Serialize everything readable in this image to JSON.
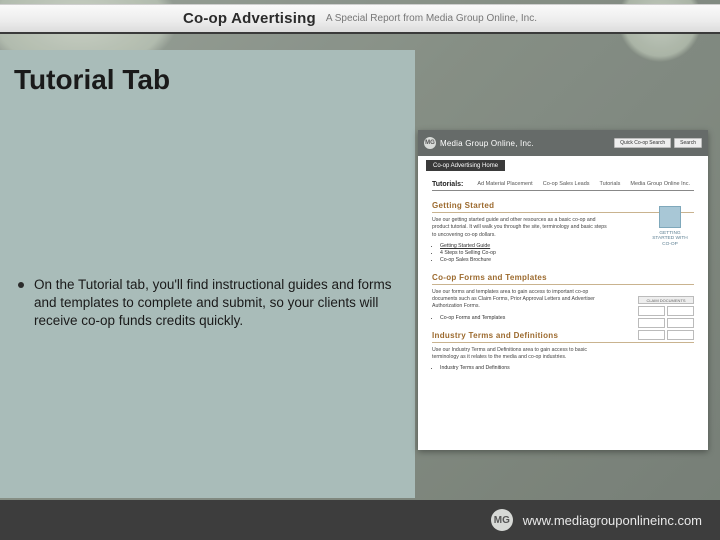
{
  "header": {
    "title": "Co-op Advertising",
    "subtitle": "A Special Report from Media Group Online, Inc."
  },
  "slide": {
    "title": "Tutorial Tab",
    "bullet": "On the Tutorial tab, you'll find instructional guides and forms and templates to complete and submit, so your clients will receive co-op funds credits quickly."
  },
  "screenshot": {
    "brand": "Media Group Online, Inc.",
    "search_label": "Quick Co-op Search",
    "search_button": "Search",
    "crumb": "Co-op Advertising Home",
    "tabs": {
      "lead": "Tutorials:",
      "items": [
        "Ad Material Placement",
        "Co-op Sales Leads",
        "Tutorials",
        "Media Group Online Inc."
      ]
    },
    "sections": [
      {
        "title": "Getting Started",
        "body": "Use our getting started guide and other resources as a basic co-op and product tutorial. It will walk you through the site, terminology and basic steps to uncovering co-op dollars.",
        "items": [
          "Getting Started Guide",
          "4 Steps to Selling Co-op",
          "Co-op Sales Brochure"
        ],
        "side_caption": "GETTING STARTED WITH CO-OP"
      },
      {
        "title": "Co-op Forms and Templates",
        "body": "Use our forms and templates area to gain access to important co-op documents such as Claim Forms, Prior Approval Letters and Advertiser Authorization Forms.",
        "items": [
          "Co-op Forms and Templates"
        ],
        "grid_header": "CLAIM DOCUMENTS"
      },
      {
        "title": "Industry Terms and Definitions",
        "body": "Use our Industry Terms and Definitions area to gain access to basic terminology as it relates to the media and co-op industries.",
        "items": [
          "Industry Terms and Definitions"
        ]
      }
    ]
  },
  "footer": {
    "logo_text": "MG",
    "url": "www.mediagrouponlineinc.com"
  }
}
